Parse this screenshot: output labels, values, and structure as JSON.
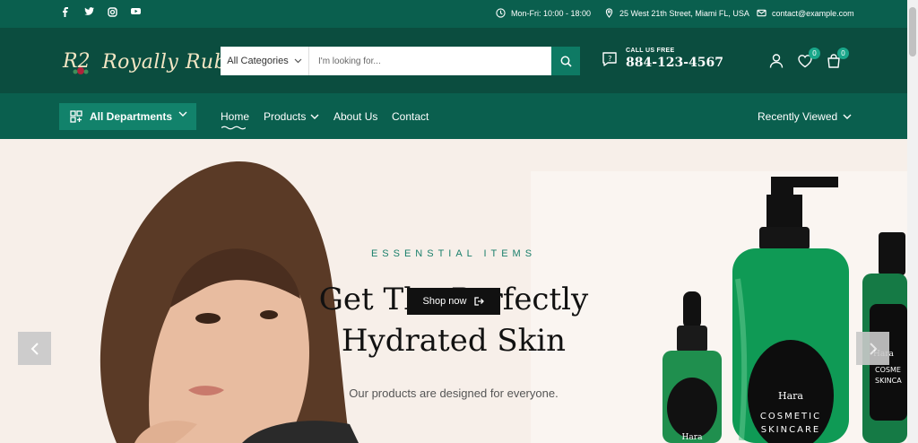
{
  "topbar": {
    "social": [
      "facebook-icon",
      "twitter-icon",
      "instagram-icon",
      "youtube-icon"
    ],
    "hours": "Mon-Fri: 10:00 - 18:00",
    "address": "25 West 21th Street, Miami FL, USA",
    "email": "contact@example.com"
  },
  "header": {
    "logo_text": "Royally Ruby",
    "logo_mark": "R2",
    "search_category": "All Categories",
    "search_placeholder": "I'm looking for...",
    "call_label": "CALL US FREE",
    "phone": "884-123-4567",
    "wishlist_count": "0",
    "cart_count": "0"
  },
  "nav": {
    "departments": "All Departments",
    "links": [
      "Home",
      "Products",
      "About Us",
      "Contact"
    ],
    "recently_viewed": "Recently Viewed"
  },
  "hero": {
    "eyebrow": "ESSENSTIAL ITEMS",
    "title_line1": "Get The Perfectly",
    "title_line2": "Hydrated Skin",
    "subtitle": "Our products are designed for everyone.",
    "cta": "Shop now",
    "bottle_brand": "Hara",
    "bottle_label_1": "COSMETIC",
    "bottle_label_2": "SKINCARE",
    "bottle_label_partial_1": "COSME",
    "bottle_label_partial_2": "SKINCA"
  },
  "colors": {
    "topbar": "#0a5f4e",
    "header": "#0b4d3f",
    "accent": "#12826b",
    "hero_bg": "#f7efe9"
  }
}
